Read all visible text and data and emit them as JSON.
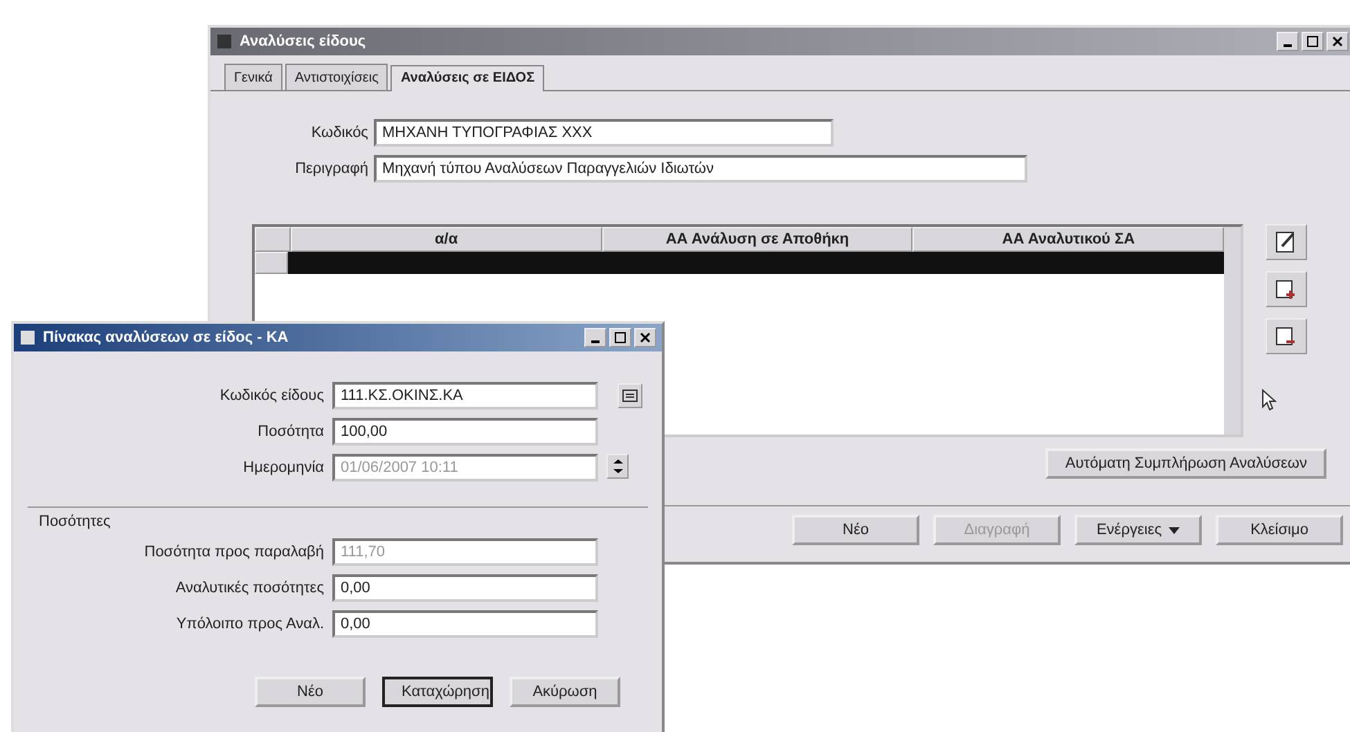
{
  "main_window": {
    "title": "Αναλύσεις είδους",
    "tabs": [
      {
        "label": "Γενικά",
        "selected": false
      },
      {
        "label": "Αντιστοιχίσεις",
        "selected": false
      },
      {
        "label": "Αναλύσεις σε ΕΙΔΟΣ",
        "selected": true
      }
    ],
    "fields": [
      {
        "label": "Κωδικός",
        "value": "ΜΗΧΑΝΗ ΤΥΠΟΓΡΑΦΙΑΣ ΧΧΧ",
        "wide": false
      },
      {
        "label": "Περιγραφή",
        "value": "Μηχανή τύπου Αναλύσεων Παραγγελιών Ιδιωτών",
        "wide": true
      }
    ],
    "table": {
      "columns": [
        "α/α",
        "ΑΑ Ανάλυση σε Αποθήκη",
        "ΑΑ Αναλυτικού ΣΑ"
      ],
      "rows": [
        {
          "selected": true
        }
      ]
    },
    "fill_button": "Αυτόματη Συμπλήρωση Αναλύσεων",
    "buttons": [
      {
        "label": "Νέο",
        "disabled": false,
        "menu": false
      },
      {
        "label": "Διαγραφή",
        "disabled": true,
        "menu": false
      },
      {
        "label": "Ενέργειες",
        "disabled": false,
        "menu": true
      },
      {
        "label": "Κλείσιμο",
        "disabled": false,
        "menu": false
      }
    ]
  },
  "dialog": {
    "title": "Πίνακας αναλύσεων σε είδος - ΚΑ",
    "fields": [
      {
        "label": "Κωδικός είδους",
        "value": "111.ΚΣ.ΟΚΙΝΣ.ΚΑ",
        "disabled": false,
        "kind": "lookup"
      },
      {
        "label": "Ποσότητα",
        "value": "100,00",
        "disabled": false,
        "kind": "text"
      },
      {
        "label": "Ημερομηνία",
        "value": "01/06/2007 10:11",
        "disabled": true,
        "kind": "dropdown"
      }
    ],
    "group": "Ποσότητες",
    "group_fields": [
      {
        "label": "Ποσότητα προς παραλαβή",
        "value": "111,70",
        "disabled": true
      },
      {
        "label": "Αναλυτικές ποσότητες",
        "value": "0,00",
        "disabled": false
      },
      {
        "label": "Υπόλοιπο προς Αναλ.",
        "value": "0,00",
        "disabled": false
      }
    ],
    "buttons": [
      {
        "label": "Νέο",
        "default": false
      },
      {
        "label": "Καταχώρηση",
        "default": true
      },
      {
        "label": "Ακύρωση",
        "default": false
      }
    ]
  }
}
